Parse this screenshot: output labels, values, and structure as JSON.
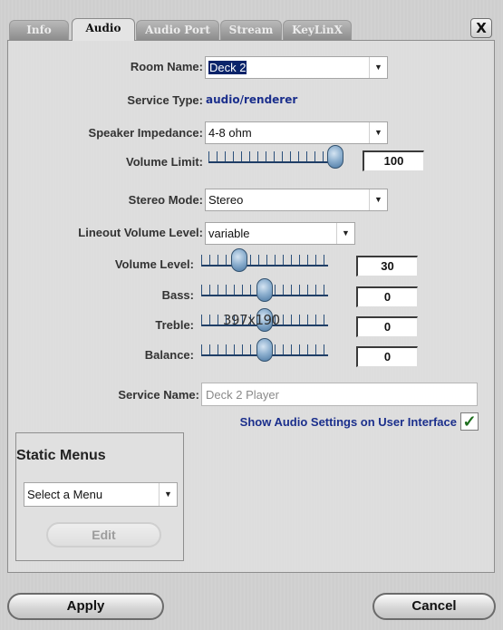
{
  "tabs": [
    "Info",
    "Audio",
    "Audio Port",
    "Stream",
    "KeyLinX"
  ],
  "active_tab": "Audio",
  "close_label": "X",
  "form": {
    "room_name_label": "Room Name:",
    "room_name_value": "Deck 2",
    "service_type_label": "Service Type:",
    "service_type_value": "audio/renderer",
    "speaker_impedance_label": "Speaker Impedance:",
    "speaker_impedance_value": "4-8 ohm",
    "volume_limit_label": "Volume Limit:",
    "volume_limit_value": "100",
    "stereo_mode_label": "Stereo Mode:",
    "stereo_mode_value": "Stereo",
    "lineout_label": "Lineout Volume Level:",
    "lineout_value": "variable",
    "volume_level_label": "Volume Level:",
    "volume_level_value": "30",
    "bass_label": "Bass:",
    "bass_value": "0",
    "treble_label": "Treble:",
    "treble_value": "0",
    "balance_label": "Balance:",
    "balance_value": "0",
    "service_name_label": "Service Name:",
    "service_name_value": "Deck 2 Player",
    "show_audio_label": "Show Audio Settings on User Interface",
    "show_audio_checked": "✓",
    "overlay_text": "397x190"
  },
  "slider_levels": {
    "volume_limit": 1.0,
    "volume_level": 0.3,
    "bass": 0.5,
    "treble": 0.5,
    "balance": 0.5
  },
  "static_menus": {
    "title": "Static Menus",
    "select_value": "Select a Menu",
    "edit_label": "Edit"
  },
  "footer": {
    "apply_label": "Apply",
    "cancel_label": "Cancel"
  },
  "icons": {
    "dropdown": "chevron-down-icon",
    "close": "close-icon",
    "check": "checkmark-icon"
  }
}
